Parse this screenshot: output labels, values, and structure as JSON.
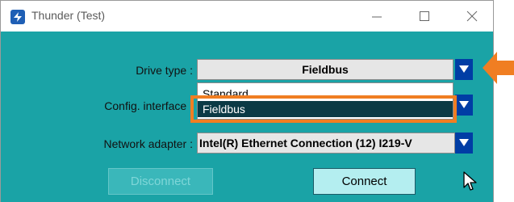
{
  "window": {
    "title": "Thunder (Test)",
    "minimize_icon": "minimize-icon",
    "maximize_icon": "maximize-icon",
    "close_icon": "close-icon"
  },
  "form": {
    "drive_type_label": "Drive type :",
    "drive_type_value": "Fieldbus",
    "config_interface_label": "Config. interface :",
    "network_adapter_label": "Network adapter :",
    "network_adapter_value": "Intel(R) Ethernet Connection (12) I219-V"
  },
  "dropdown": {
    "options": [
      "Standard",
      "Fieldbus"
    ],
    "selected": "Fieldbus"
  },
  "buttons": {
    "disconnect": "Disconnect",
    "connect": "Connect"
  },
  "colors": {
    "client_bg": "#1aa3a6",
    "arrow_bg": "#003da5",
    "highlight": "#f07e22",
    "selected_option_bg": "#0b3a45"
  }
}
